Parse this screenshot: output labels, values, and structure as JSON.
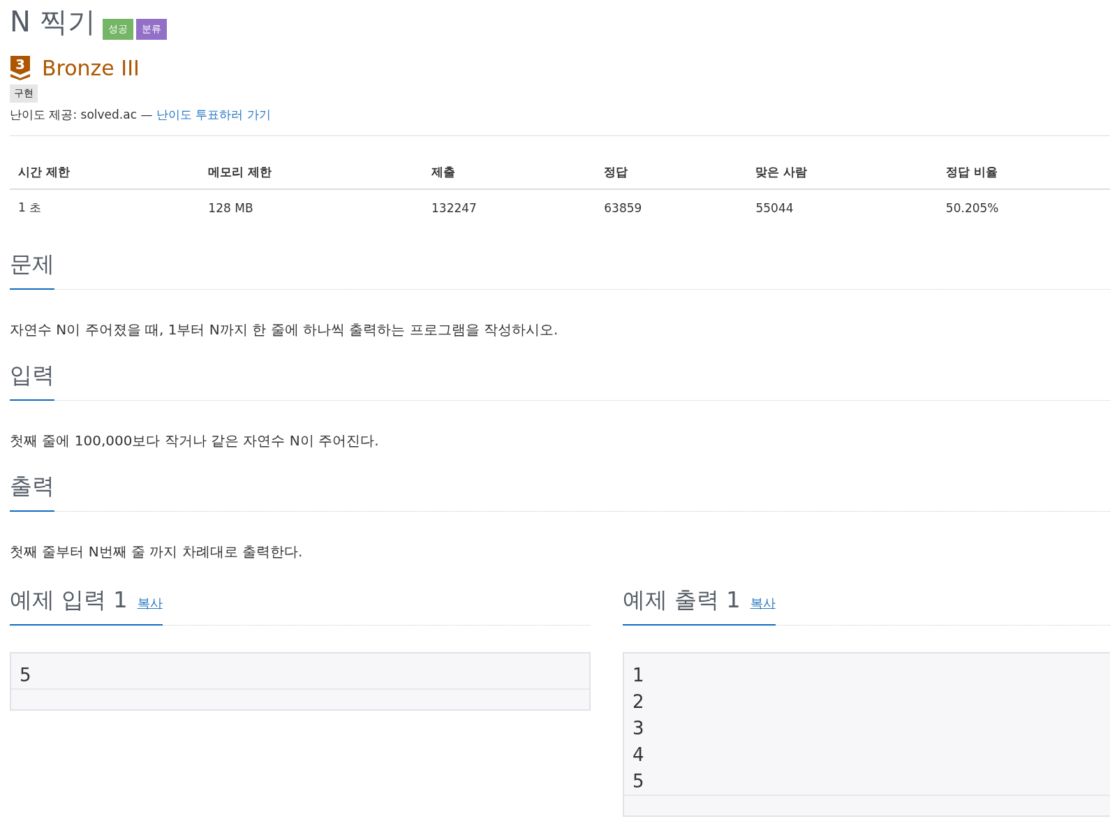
{
  "problem": {
    "title": "N 찍기",
    "badges": [
      {
        "label": "성공",
        "color": "#74b566"
      },
      {
        "label": "분류",
        "color": "#9370c7"
      }
    ]
  },
  "tier": {
    "icon_number": "3",
    "name": "Bronze III"
  },
  "tags": [
    "구현"
  ],
  "difficulty_note": {
    "text": "난이도 제공: solved.ac —",
    "link": "난이도 투표하러 가기"
  },
  "table": {
    "columns": [
      "시간 제한",
      "메모리 제한",
      "제출",
      "정답",
      "맞은 사람",
      "정답 비율"
    ],
    "rows": [
      [
        "1 초",
        "128 MB",
        "132247",
        "63859",
        "55044",
        "50.205%"
      ]
    ]
  },
  "sections": [
    {
      "heading": "문제",
      "body": "자연수 N이 주어졌을 때, 1부터 N까지 한 줄에 하나씩 출력하는 프로그램을 작성하시오."
    },
    {
      "heading": "입력",
      "body": "첫째 줄에 100,000보다 작거나 같은 자연수 N이 주어진다."
    },
    {
      "heading": "출력",
      "body": "첫째 줄부터 N번째 줄 까지 차례대로 출력한다."
    }
  ],
  "samples": [
    {
      "heading": "예제 입력 1",
      "copy": "복사",
      "lines": [
        "5"
      ]
    },
    {
      "heading": "예제 출력 1",
      "copy": "복사",
      "lines": [
        "1",
        "2",
        "3",
        "4",
        "5"
      ]
    }
  ]
}
